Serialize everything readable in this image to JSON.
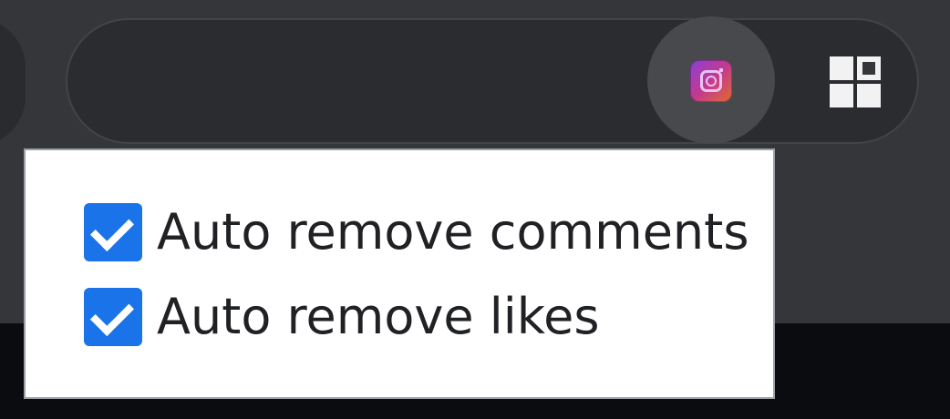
{
  "toolbar": {
    "extension_icon": "instagram-like-extension-icon",
    "extensions_menu_icon": "puzzle-grid-icon"
  },
  "popup": {
    "options": [
      {
        "label": "Auto remove comments",
        "checked": true
      },
      {
        "label": "Auto remove likes",
        "checked": true
      }
    ]
  },
  "colors": {
    "toolbar_background": "#35363a",
    "checkbox_accent": "#1a73e8",
    "popup_background": "#ffffff"
  }
}
